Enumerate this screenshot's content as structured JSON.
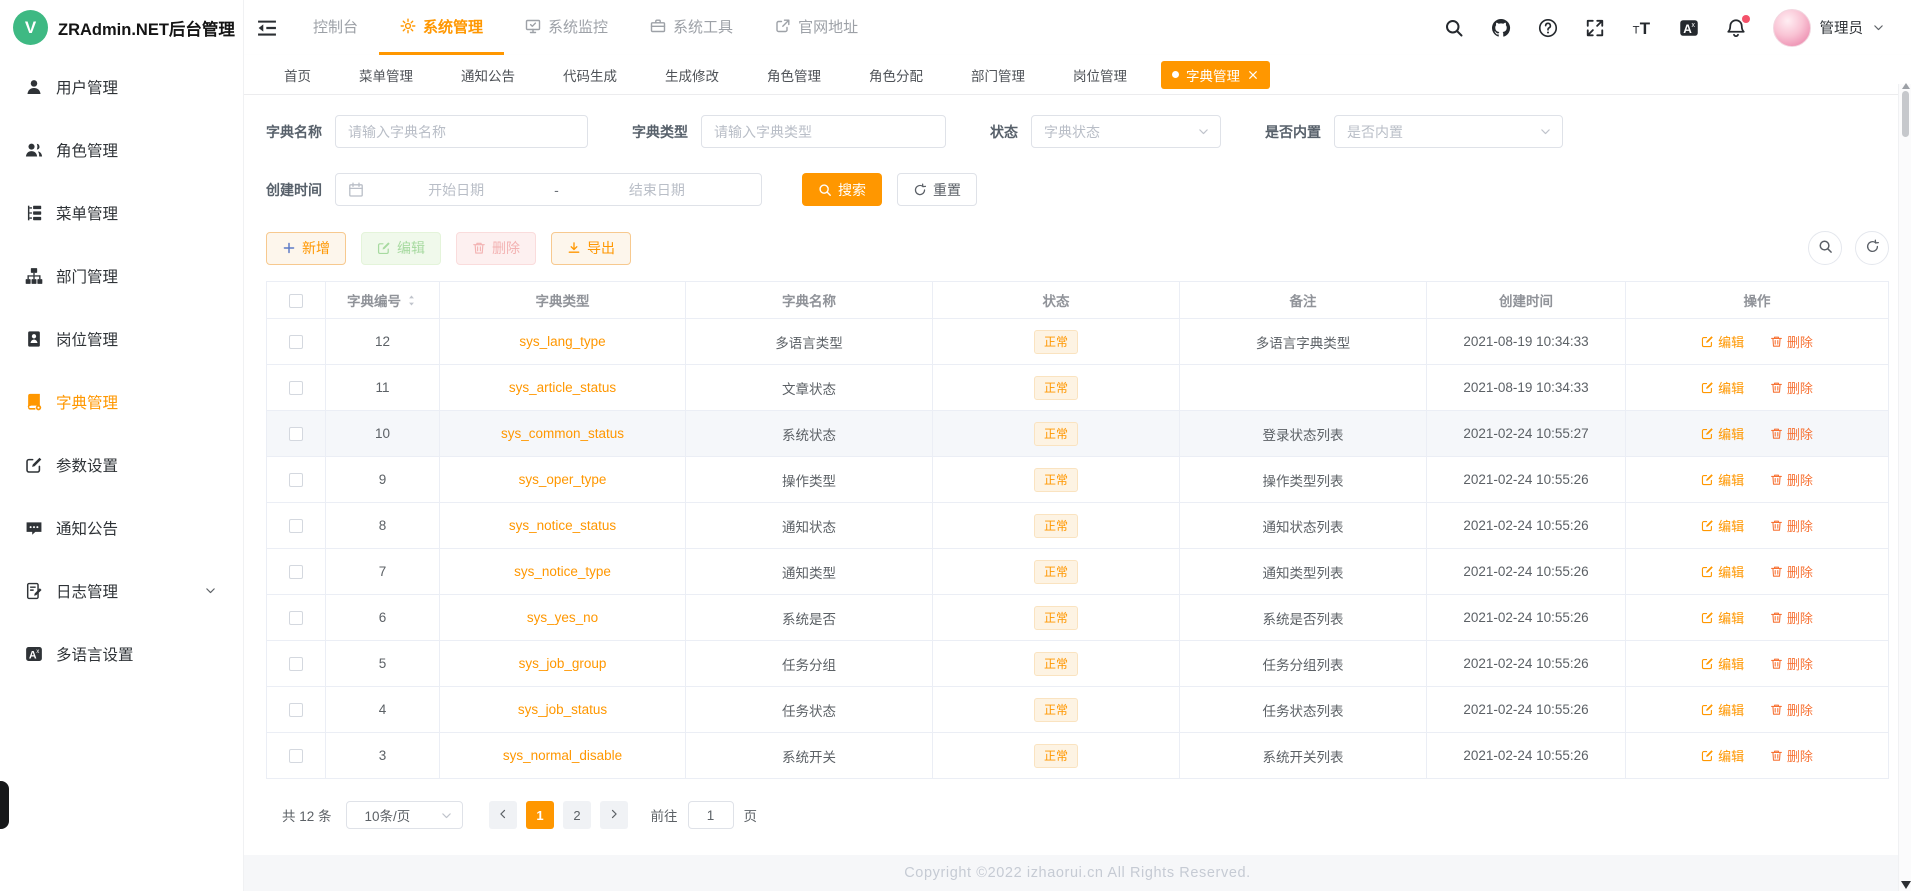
{
  "app": {
    "title": "ZRAdmin.NET后台管理",
    "logo_letter": "V"
  },
  "colors": {
    "accent": "#ff9700",
    "logo_green": "#3eb983",
    "badge_red": "#f4526a"
  },
  "topnav": {
    "items": [
      {
        "label": "控制台"
      },
      {
        "label": "系统管理",
        "icon": "gear",
        "active": true
      },
      {
        "label": "系统监控",
        "icon": "monitor"
      },
      {
        "label": "系统工具",
        "icon": "toolbox"
      },
      {
        "label": "官网地址",
        "icon": "external-link"
      }
    ],
    "user": {
      "name": "管理员"
    }
  },
  "sidebar": {
    "items": [
      {
        "label": "用户管理",
        "icon": "user"
      },
      {
        "label": "角色管理",
        "icon": "users"
      },
      {
        "label": "菜单管理",
        "icon": "tree-list"
      },
      {
        "label": "部门管理",
        "icon": "org-tree"
      },
      {
        "label": "岗位管理",
        "icon": "badge"
      },
      {
        "label": "字典管理",
        "icon": "dictionary",
        "active": true
      },
      {
        "label": "参数设置",
        "icon": "edit-square"
      },
      {
        "label": "通知公告",
        "icon": "message"
      },
      {
        "label": "日志管理",
        "icon": "log",
        "expandable": true
      },
      {
        "label": "多语言设置",
        "icon": "translate"
      }
    ]
  },
  "tabs": {
    "items": [
      {
        "label": "首页"
      },
      {
        "label": "菜单管理"
      },
      {
        "label": "通知公告"
      },
      {
        "label": "代码生成"
      },
      {
        "label": "生成修改"
      },
      {
        "label": "角色管理"
      },
      {
        "label": "角色分配"
      },
      {
        "label": "部门管理"
      },
      {
        "label": "岗位管理"
      },
      {
        "label": "字典管理",
        "active": true,
        "closable": true
      }
    ]
  },
  "filter": {
    "name_label": "字典名称",
    "name_placeholder": "请输入字典名称",
    "type_label": "字典类型",
    "type_placeholder": "请输入字典类型",
    "status_label": "状态",
    "status_placeholder": "字典状态",
    "builtin_label": "是否内置",
    "builtin_placeholder": "是否内置",
    "time_label": "创建时间",
    "start_placeholder": "开始日期",
    "range_separator": "-",
    "end_placeholder": "结束日期",
    "search_label": "搜索",
    "reset_label": "重置"
  },
  "toolbar": {
    "add_label": "新增",
    "edit_label": "编辑",
    "delete_label": "删除",
    "export_label": "导出"
  },
  "table": {
    "columns": {
      "id": "字典编号",
      "type": "字典类型",
      "name": "字典名称",
      "status": "状态",
      "remark": "备注",
      "created": "创建时间",
      "actions": "操作"
    },
    "row_actions": {
      "edit": "编辑",
      "delete": "删除"
    },
    "rows": [
      {
        "id": "12",
        "type": "sys_lang_type",
        "name": "多语言类型",
        "status": "正常",
        "remark": "多语言字典类型",
        "created": "2021-08-19 10:34:33"
      },
      {
        "id": "11",
        "type": "sys_article_status",
        "name": "文章状态",
        "status": "正常",
        "remark": "",
        "created": "2021-08-19 10:34:33"
      },
      {
        "id": "10",
        "type": "sys_common_status",
        "name": "系统状态",
        "status": "正常",
        "remark": "登录状态列表",
        "created": "2021-02-24 10:55:27",
        "highlight": true
      },
      {
        "id": "9",
        "type": "sys_oper_type",
        "name": "操作类型",
        "status": "正常",
        "remark": "操作类型列表",
        "created": "2021-02-24 10:55:26"
      },
      {
        "id": "8",
        "type": "sys_notice_status",
        "name": "通知状态",
        "status": "正常",
        "remark": "通知状态列表",
        "created": "2021-02-24 10:55:26"
      },
      {
        "id": "7",
        "type": "sys_notice_type",
        "name": "通知类型",
        "status": "正常",
        "remark": "通知类型列表",
        "created": "2021-02-24 10:55:26"
      },
      {
        "id": "6",
        "type": "sys_yes_no",
        "name": "系统是否",
        "status": "正常",
        "remark": "系统是否列表",
        "created": "2021-02-24 10:55:26"
      },
      {
        "id": "5",
        "type": "sys_job_group",
        "name": "任务分组",
        "status": "正常",
        "remark": "任务分组列表",
        "created": "2021-02-24 10:55:26"
      },
      {
        "id": "4",
        "type": "sys_job_status",
        "name": "任务状态",
        "status": "正常",
        "remark": "任务状态列表",
        "created": "2021-02-24 10:55:26"
      },
      {
        "id": "3",
        "type": "sys_normal_disable",
        "name": "系统开关",
        "status": "正常",
        "remark": "系统开关列表",
        "created": "2021-02-24 10:55:26"
      }
    ]
  },
  "pagination": {
    "total": "共 12 条",
    "page_size": "10条/页",
    "pages": [
      {
        "label": "1",
        "active": true
      },
      {
        "label": "2"
      }
    ],
    "goto_label": "前往",
    "goto_value": "1",
    "unit_label": "页"
  },
  "footer": {
    "copyright": "Copyright ©2022 izhaorui.cn All Rights Reserved."
  }
}
